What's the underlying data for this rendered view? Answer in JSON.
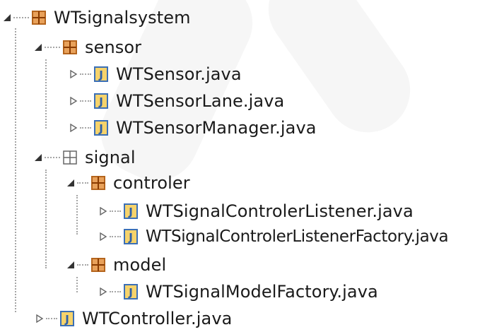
{
  "tree": {
    "root": {
      "label": "WTsignalsystem",
      "icon": "package-icon",
      "expanded": true
    },
    "sensor": {
      "label": "sensor",
      "icon": "package-icon",
      "expanded": true,
      "files": [
        {
          "label": "WTSensor.java",
          "icon": "java-file-icon"
        },
        {
          "label": "WTSensorLane.java",
          "icon": "java-file-icon"
        },
        {
          "label": "WTSensorManager.java",
          "icon": "java-file-icon"
        }
      ]
    },
    "signal": {
      "label": "signal",
      "icon": "empty-package-icon",
      "expanded": true,
      "controler": {
        "label": "controler",
        "icon": "package-icon",
        "expanded": true,
        "files": [
          {
            "label": "WTSignalControlerListener.java",
            "icon": "java-file-icon"
          },
          {
            "label": "WTSignalControlerListenerFactory.java",
            "icon": "java-file-icon"
          }
        ]
      },
      "model": {
        "label": "model",
        "icon": "package-icon",
        "expanded": true,
        "files": [
          {
            "label": "WTSignalModelFactory.java",
            "icon": "java-file-icon"
          }
        ]
      }
    },
    "root_files": [
      {
        "label": "WTController.java",
        "icon": "java-file-icon"
      }
    ]
  },
  "colors": {
    "package": "#b5651d",
    "package_empty": "#555555",
    "java_file_border": "#3b6fb6",
    "java_file_fill": "#f4c542",
    "java_letter": "#2d5fa8",
    "connector": "#a6a6a6"
  }
}
